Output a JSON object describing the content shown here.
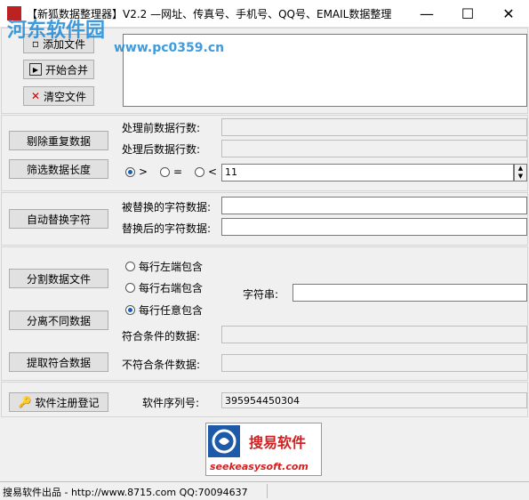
{
  "window": {
    "title": "【新狐数据整理器】V2.2 —网址、传真号、手机号、QQ号、EMAIL数据整理",
    "minimize": "—",
    "maximize": "☐",
    "close": "✕"
  },
  "watermark": {
    "line1": "河东软件园",
    "line2": "www.pc0359.cn"
  },
  "files": {
    "add_button": "添加文件",
    "merge_button": "开始合并",
    "clear_button": "清空文件"
  },
  "dedupe": {
    "button": "剔除重复数据",
    "before_label": "处理前数据行数:",
    "before_value": "",
    "after_label": "处理后数据行数:",
    "after_value": ""
  },
  "length_filter": {
    "button": "筛选数据长度",
    "options": [
      ">",
      "=",
      "<"
    ],
    "selected": ">",
    "value": "11"
  },
  "replace": {
    "button": "自动替换字符",
    "find_label": "被替换的字符数据:",
    "find_value": "",
    "replace_label": "替换后的字符数据:",
    "replace_value": ""
  },
  "split": {
    "split_button": "分割数据文件",
    "separate_button": "分离不同数据",
    "extract_button": "提取符合数据",
    "modes": [
      "每行左端包含",
      "每行右端包含",
      "每行任意包含"
    ],
    "selected_mode": "每行任意包含",
    "string_label": "字符串:",
    "string_value": "",
    "match_label": "符合条件的数据:",
    "match_value": "",
    "nomatch_label": "不符合条件数据:",
    "nomatch_value": ""
  },
  "registration": {
    "button": "软件注册登记",
    "serial_label": "软件序列号:",
    "serial_value": "395954450304"
  },
  "logo": {
    "brand": "搜易软件",
    "url": "seekeasysoft.com"
  },
  "status": {
    "text": "搜易软件出品 - http://www.8715.com QQ:70094637"
  },
  "colors": {
    "accent": "#1a5fb4",
    "logo_red": "#d42020",
    "logo_blue": "#1e5aa8"
  }
}
